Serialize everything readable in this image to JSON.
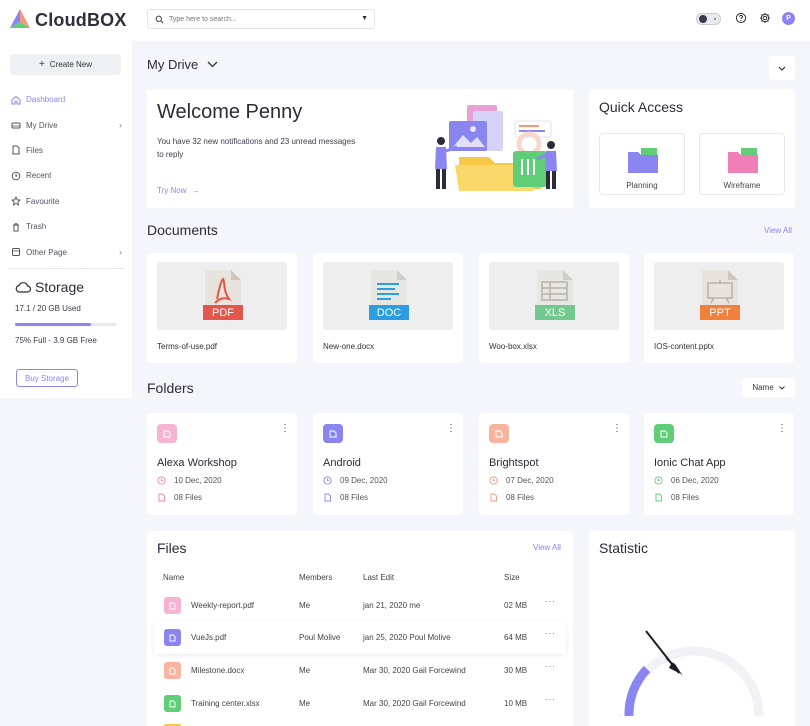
{
  "app": {
    "name": "CloudBOX"
  },
  "sidebar": {
    "create_label": "Create New",
    "items": [
      {
        "label": "Dashboard",
        "icon": "home-icon",
        "active": true
      },
      {
        "label": "My Drive",
        "icon": "drive-icon",
        "has_arrow": true
      },
      {
        "label": "Files",
        "icon": "file-icon"
      },
      {
        "label": "Recent",
        "icon": "clock-icon"
      },
      {
        "label": "Favourite",
        "icon": "star-icon"
      },
      {
        "label": "Trash",
        "icon": "trash-icon"
      },
      {
        "label": "Other Page",
        "icon": "pages-icon",
        "has_arrow": true
      }
    ],
    "storage": {
      "title": "Storage",
      "used": "17.1 / 20 GB Used",
      "used_fraction": 0.75,
      "free": "75% Full - 3.9 GB Free",
      "buy_label": "Buy Storage"
    }
  },
  "topbar": {
    "search_placeholder": "Type here to search...",
    "avatar_initial": "P"
  },
  "main": {
    "title": "My Drive",
    "welcome": {
      "title": "Welcome Penny",
      "text": "You have 32 new notifications and 23 unread messages to reply",
      "link": "Try Now"
    },
    "quick_access": {
      "title": "Quick Access",
      "items": [
        {
          "label": "Planning",
          "color": "#8a85f0"
        },
        {
          "label": "Wireframe",
          "color": "#f07fb8"
        }
      ]
    },
    "documents": {
      "title": "Documents",
      "view_all": "View All",
      "items": [
        {
          "name": "Terms-of-use.pdf",
          "type": "PDF",
          "color": "#e2574c"
        },
        {
          "name": "New-one.docx",
          "type": "DOC",
          "color": "#2a9de3"
        },
        {
          "name": "Woo-box.xlsx",
          "type": "XLS",
          "color": "#73c98d"
        },
        {
          "name": "IOS-content.pptx",
          "type": "PPT",
          "color": "#f0803c"
        }
      ]
    },
    "folders": {
      "title": "Folders",
      "sort_label": "Name",
      "items": [
        {
          "name": "Alexa Workshop",
          "date": "10 Dec, 2020",
          "files": "08 Files",
          "color": "#f07fb8",
          "bg": "#fde4ef"
        },
        {
          "name": "Android",
          "date": "09 Dec, 2020",
          "files": "08 Files",
          "color": "#8a85f0",
          "bg": "#e6e4fd"
        },
        {
          "name": "Brightspot",
          "date": "07 Dec, 2020",
          "files": "08 Files",
          "color": "#f5977a",
          "bg": "#fde8e0"
        },
        {
          "name": "Ionic Chat App",
          "date": "06 Dec, 2020",
          "files": "08 Files",
          "color": "#5fce77",
          "bg": "#e1f6e5"
        }
      ]
    },
    "files": {
      "title": "Files",
      "view_all": "View All",
      "columns": [
        "Name",
        "Members",
        "Last Edit",
        "Size"
      ],
      "rows": [
        {
          "name": "Weekly-report.pdf",
          "members": "Me",
          "last_edit": "jan 21, 2020 me",
          "size": "02 MB",
          "color": "#f07fb8"
        },
        {
          "name": "VueJs.pdf",
          "members": "Poul Molive",
          "last_edit": "jan 25, 2020 Poul Molive",
          "size": "64 MB",
          "color": "#8a85f0"
        },
        {
          "name": "Milestone.docx",
          "members": "Me",
          "last_edit": "Mar 30, 2020 Gail Forcewind",
          "size": "30 MB",
          "color": "#f5977a"
        },
        {
          "name": "Training center.xlsx",
          "members": "Me",
          "last_edit": "Mar 30, 2020 Gail Forcewind",
          "size": "10 MB",
          "color": "#5fce77"
        }
      ]
    },
    "statistic": {
      "title": "Statistic"
    }
  },
  "colors": {
    "accent": "#8a85f0"
  }
}
